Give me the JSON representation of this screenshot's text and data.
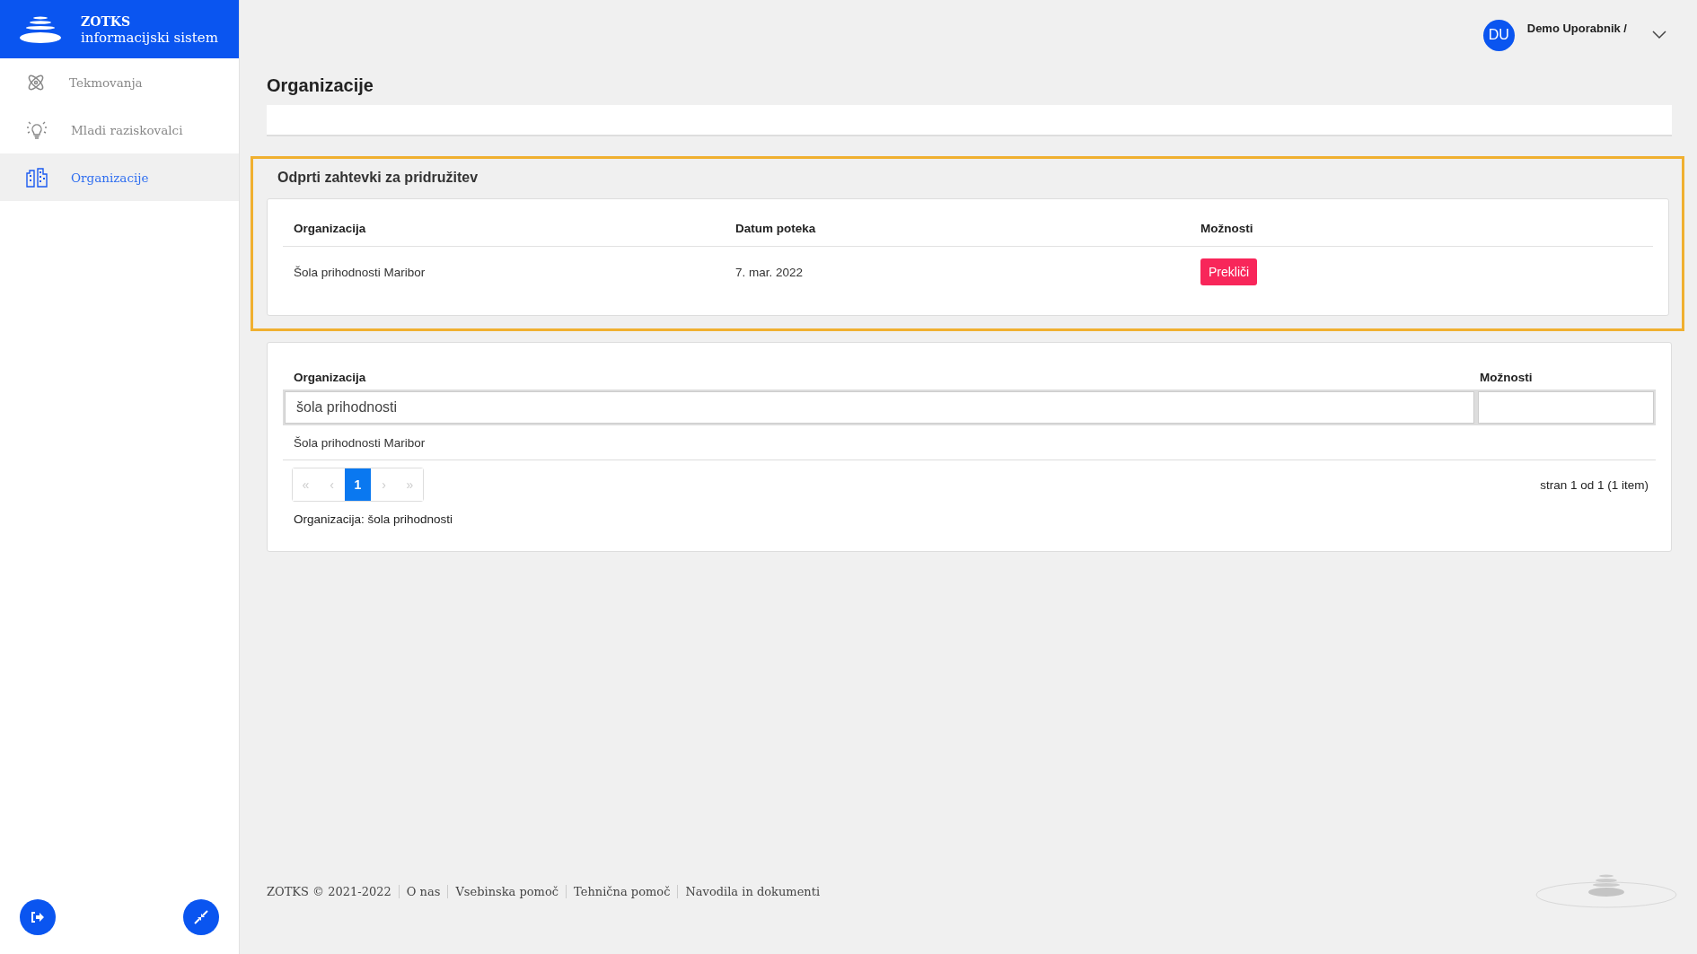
{
  "brand": {
    "name": "ZOTKS",
    "subtitle": "informacijski sistem"
  },
  "sidebar": {
    "items": [
      {
        "label": "Tekmovanja",
        "selected": false
      },
      {
        "label": "Mladi raziskovalci",
        "selected": false
      },
      {
        "label": "Organizacije",
        "selected": true
      }
    ]
  },
  "user": {
    "initials": "DU",
    "name": "Demo Uporabnik /"
  },
  "page_title": "Organizacije",
  "requests": {
    "title": "Odprti zahtevki za pridružitev",
    "columns": [
      "Organizacija",
      "Datum poteka",
      "Možnosti"
    ],
    "rows": [
      {
        "organization": "Šola prihodnosti Maribor",
        "date": "7. mar. 2022",
        "action": "Prekliči"
      }
    ]
  },
  "organizations": {
    "columns": [
      "Organizacija",
      "Možnosti"
    ],
    "filter": {
      "value": "šola prihodnosti"
    },
    "rows": [
      {
        "organization": "Šola prihodnosti Maribor"
      }
    ],
    "pagination": [
      {
        "label": "«",
        "selected": false,
        "disabled": true
      },
      {
        "label": "‹",
        "selected": false,
        "disabled": true
      },
      {
        "label": "1",
        "selected": true,
        "disabled": false
      },
      {
        "label": "›",
        "selected": false,
        "disabled": true
      },
      {
        "label": "»",
        "selected": false,
        "disabled": true
      }
    ],
    "page_info": "stran 1 od 1 (1 item)",
    "active_filter": "Organizacija: šola prihodnosti"
  },
  "footer": {
    "links": [
      "ZOTKS © 2021-2022",
      "O nas",
      "Vsebinska pomoč",
      "Tehnična pomoč",
      "Navodila in dokumenti"
    ]
  }
}
